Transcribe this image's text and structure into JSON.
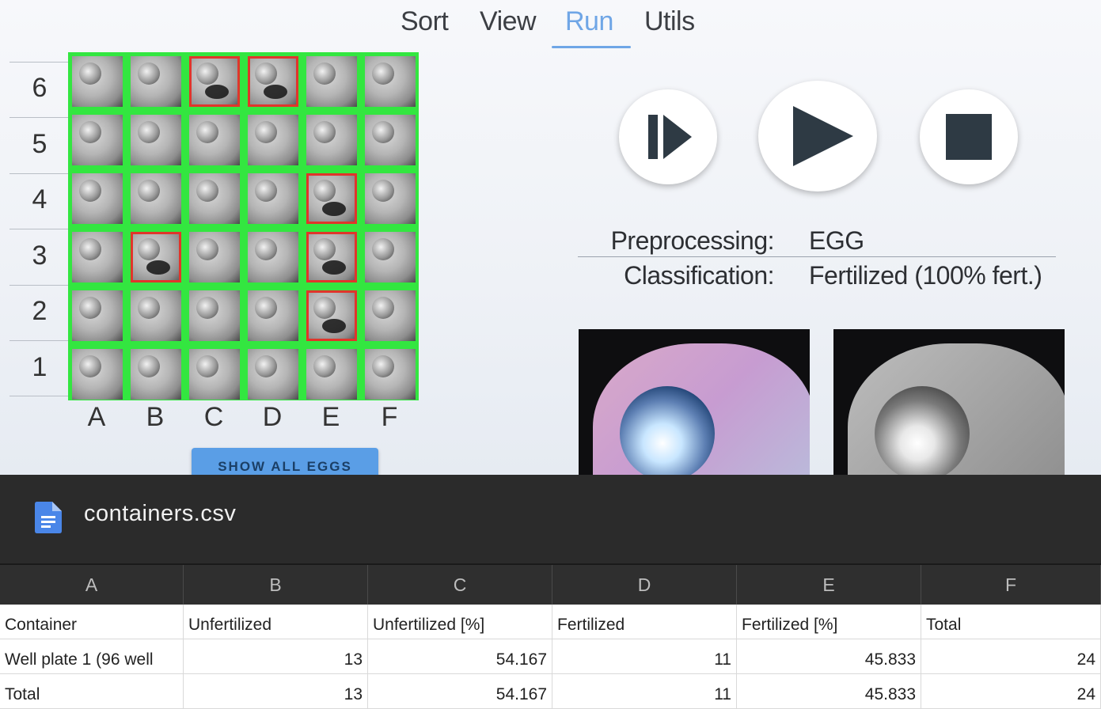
{
  "menu": {
    "items": [
      {
        "label": "Sort"
      },
      {
        "label": "View"
      },
      {
        "label": "Run",
        "active": true
      },
      {
        "label": "Utils"
      }
    ]
  },
  "plate": {
    "rows": [
      "6",
      "5",
      "4",
      "3",
      "2",
      "1"
    ],
    "columns": [
      "A",
      "B",
      "C",
      "D",
      "E",
      "F"
    ],
    "status_colors": {
      "fertilized": "#33e640",
      "unfertilized": "#e0352b"
    },
    "flagged_wells": [
      "C6",
      "D6",
      "E4",
      "B3",
      "E3",
      "E2"
    ],
    "show_all_label": "SHOW ALL EGGS"
  },
  "controls": {
    "step": {
      "icon": "step-forward-icon"
    },
    "play": {
      "icon": "play-icon"
    },
    "stop": {
      "icon": "stop-icon"
    }
  },
  "info": {
    "preprocessing_label": "Preprocessing:",
    "preprocessing_value": "EGG",
    "classification_label": "Classification:",
    "classification_value": "Fertilized (100% fert.)"
  },
  "csv": {
    "filename": "containers.csv",
    "icon": "document-icon",
    "column_letters": [
      "A",
      "B",
      "C",
      "D",
      "E",
      "F"
    ],
    "rows": [
      [
        "Container",
        "Unfertilized",
        "Unfertilized [%]",
        "Fertilized",
        "Fertilized [%]",
        "Total"
      ],
      [
        "Well plate 1 (96 well",
        "13",
        "54.167",
        "11",
        "45.833",
        "24"
      ],
      [
        "Total",
        "13",
        "54.167",
        "11",
        "45.833",
        "24"
      ]
    ]
  }
}
